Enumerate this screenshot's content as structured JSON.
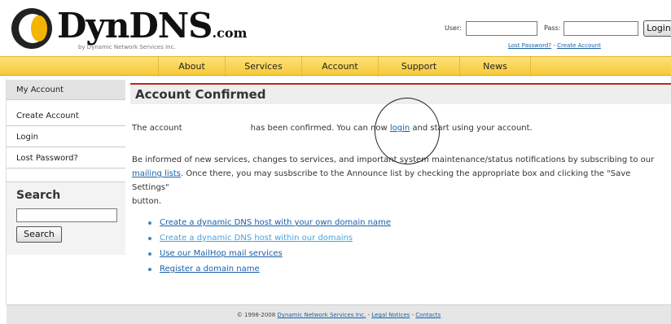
{
  "logo": {
    "brand": "DynDNS",
    "suffix": ".com",
    "tagline": "by Dynamic Network Services Inc."
  },
  "login": {
    "user_label": "User:",
    "pass_label": "Pass:",
    "button": "Login",
    "lost_password": "Lost Password?",
    "separator": "-",
    "create_account": "Create Account"
  },
  "nav": {
    "items": [
      "About",
      "Services",
      "Account",
      "Support",
      "News"
    ]
  },
  "sidebar": {
    "items": [
      "My Account",
      "Create Account",
      "Login",
      "Lost Password?"
    ],
    "search_title": "Search",
    "search_button": "Search"
  },
  "main": {
    "title": "Account Confirmed",
    "confirm_pre": "The account",
    "confirm_mid": "has been confirmed. You can now",
    "confirm_link": "login",
    "confirm_post": "and start using your account.",
    "info_line1": "Be informed of new services, changes to services, and important system maintenance/status notifications by subscribing to our",
    "info_link": "mailing lists",
    "info_line2": ". Once there, you may susbscribe to the Announce list by checking the appropriate box and clicking the \"Save Settings\"",
    "info_line3": "button.",
    "bullets": [
      "Create a dynamic DNS host with your own domain name",
      "Create a dynamic DNS host within our domains",
      "Use our MailHop mail services",
      "Register a domain name"
    ]
  },
  "footer": {
    "copyright": "© 1998-2008",
    "company": "Dynamic Network Services Inc.",
    "sep1": "-",
    "legal": "Legal Notices",
    "sep2": "-",
    "contacts": "Contacts"
  }
}
